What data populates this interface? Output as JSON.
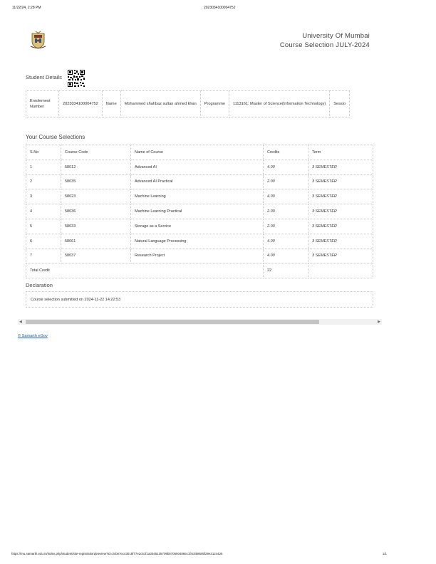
{
  "print_header": {
    "date": "11/22/24, 2:28 PM",
    "title": "2023034100004752"
  },
  "university": {
    "name": "University Of Mumbai",
    "subtitle": "Course Selection JULY-2024"
  },
  "student": {
    "heading": "Student Details",
    "enrolment_label": "Enrolement Number",
    "enrolment_value": "2023034100004752",
    "name_label": "Name",
    "name_value": "Mohammed shahbaz sultan ahmed khan",
    "programme_label": "Programme",
    "programme_value": "1113161: Master of Science(Information Technology)",
    "session_label": "Sessio"
  },
  "courses": {
    "heading": "Your Course Selections",
    "columns": [
      "S.No",
      "Course Code",
      "Name of Course",
      "Credits",
      "Term"
    ],
    "rows": [
      [
        "1",
        "58012",
        "Advanced AI",
        "4.00",
        "3 SEMESTER"
      ],
      [
        "2",
        "58035",
        "Advanced AI Practical",
        "2.00",
        "3 SEMESTER"
      ],
      [
        "3",
        "58023",
        "Machine Learning",
        "4.00",
        "3 SEMESTER"
      ],
      [
        "4",
        "58036",
        "Machine Learning Practical",
        "2.00",
        "3 SEMESTER"
      ],
      [
        "5",
        "58033",
        "Storage as a Service",
        "2.00",
        "3 SEMESTER"
      ],
      [
        "6",
        "58061",
        "Natural Language Processing",
        "4.00",
        "3 SEMESTER"
      ],
      [
        "7",
        "58037",
        "Research Project",
        "4.00",
        "3 SEMESTER"
      ]
    ],
    "total_label": "Total Credit",
    "total_value": "22"
  },
  "declaration": {
    "heading": "Declaration",
    "text": "Course selection submitted on 2024-11-22 14:22:53"
  },
  "footer_link": "© Samarth eGov",
  "print_footer": {
    "url": "https://mu.samarth.edu.in/index.php/student/site-registration/preview?id=3cb67ec43015f77e2c51f1a3045135709b5705504866c1f4c5b8605f29e3124425",
    "page": "1/1"
  },
  "colors": {
    "link": "#1a5fb4",
    "border": "#c8c8c8",
    "text": "#333333"
  },
  "icons": [
    "university-logo",
    "qr-code",
    "scroll-left-arrow",
    "scroll-right-arrow"
  ]
}
